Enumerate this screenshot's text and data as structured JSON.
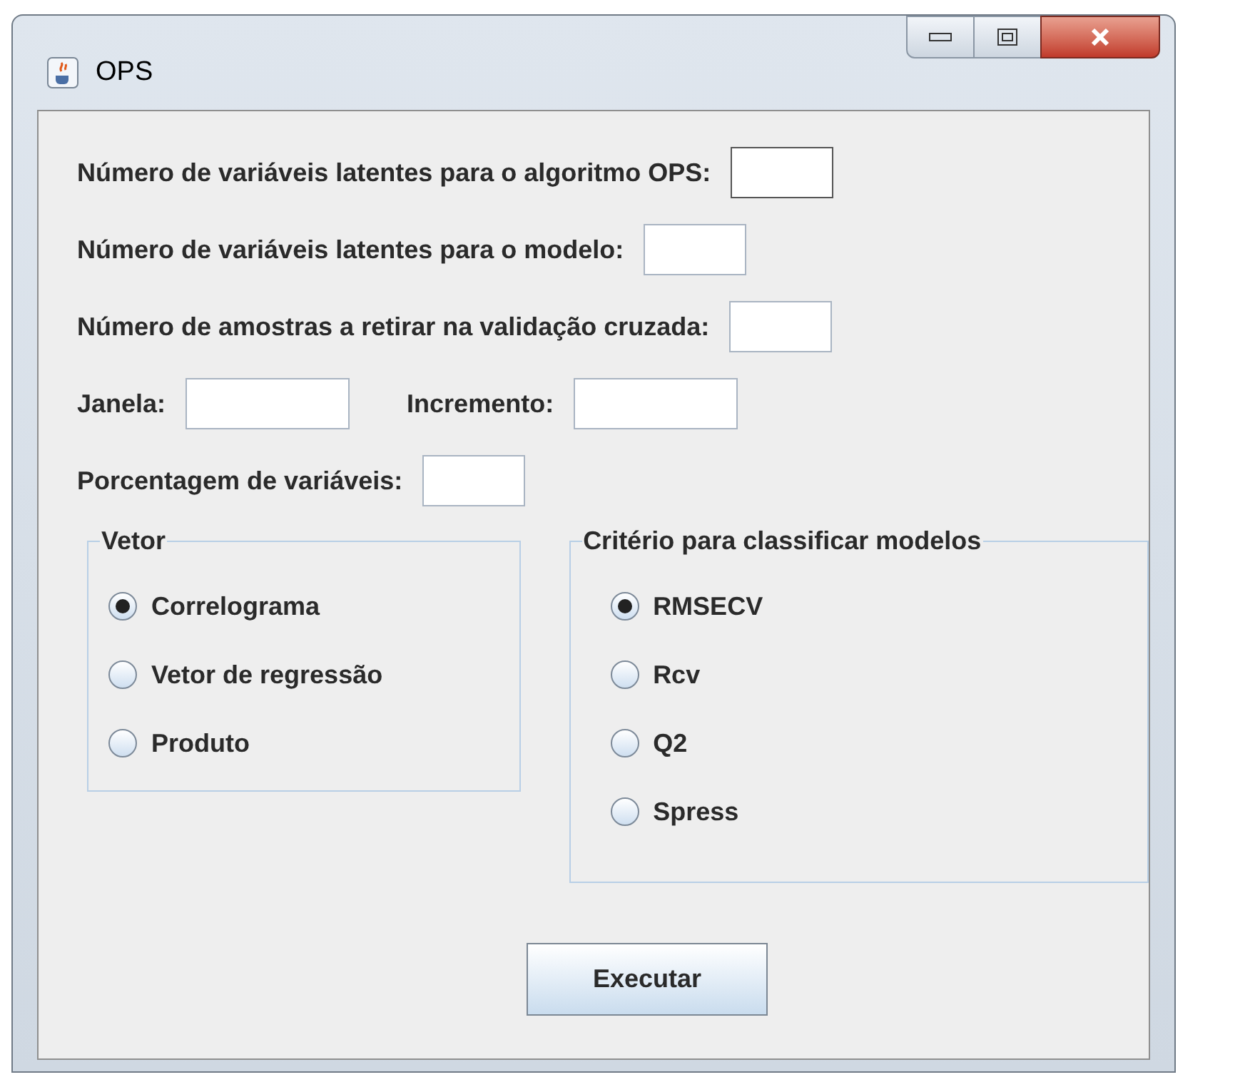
{
  "window": {
    "title": "OPS"
  },
  "rows": [
    {
      "fields": [
        {
          "label": "Número de variáveis latentes para o algoritmo OPS:",
          "focused": true
        }
      ]
    },
    {
      "fields": [
        {
          "label": "Número de variáveis latentes para o modelo:",
          "focused": false
        }
      ]
    },
    {
      "fields": [
        {
          "label": "Número de amostras a retirar na validação cruzada:",
          "focused": false
        }
      ]
    },
    {
      "fields": [
        {
          "label": "Janela:",
          "focused": false
        },
        {
          "label": "Incremento:",
          "focused": false
        }
      ]
    },
    {
      "fields": [
        {
          "label": "Porcentagem de variáveis:",
          "focused": false
        }
      ]
    }
  ],
  "groups": [
    {
      "title": "Vetor",
      "options": [
        {
          "label": "Correlograma",
          "selected": true
        },
        {
          "label": "Vetor de regressão",
          "selected": false
        },
        {
          "label": "Produto",
          "selected": false
        }
      ]
    },
    {
      "title": "Critério para classificar modelos",
      "options": [
        {
          "label": "RMSECV",
          "selected": true
        },
        {
          "label": "Rcv",
          "selected": false
        },
        {
          "label": "Q2",
          "selected": false
        },
        {
          "label": "Spress",
          "selected": false
        }
      ]
    }
  ],
  "button": {
    "label": "Executar"
  }
}
